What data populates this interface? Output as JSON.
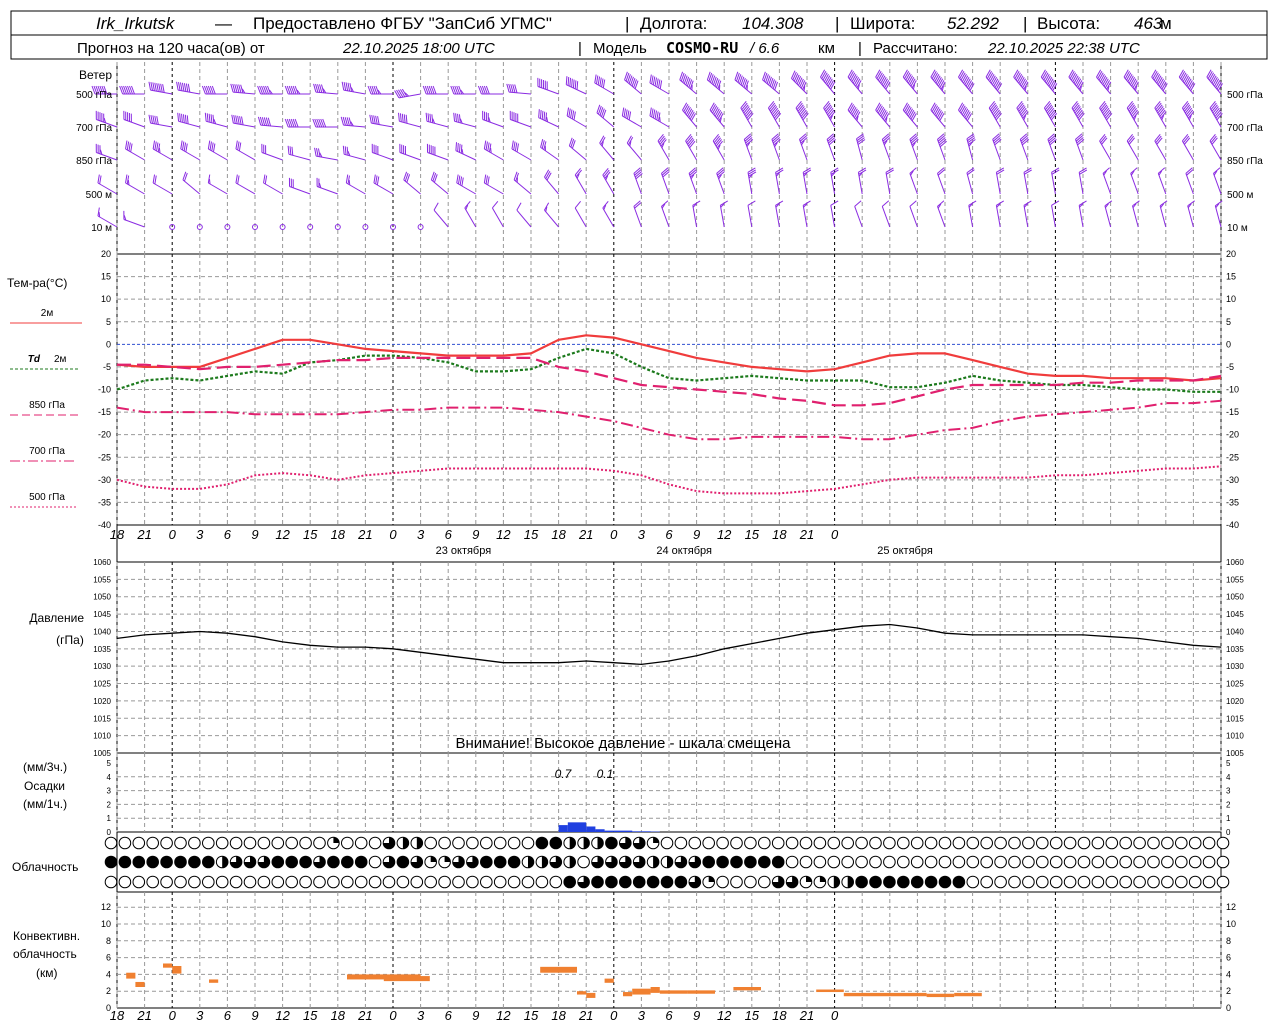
{
  "header": {
    "station": "Irk_Irkutsk",
    "sep1": "—",
    "provided": "Предоставлено ФГБУ \"ЗапСиб УГМС\"",
    "lon_label": "Долгота:",
    "lon": "104.308",
    "lat_label": "Широта:",
    "lat": "52.292",
    "alt_label": "Высота:",
    "alt": "463",
    "alt_unit": "м",
    "forecast_label": "Прогноз на 120 часа(ов) от",
    "forecast_start": "22.10.2025 18:00 UTC",
    "model_label": "Модель",
    "model": "COSMO-RU",
    "model_res": "/ 6.6",
    "model_res_unit": "км",
    "calc_label": "Рассчитано:",
    "calc_time": "22.10.2025 22:38 UTC"
  },
  "time_axis": {
    "hour_ticks": [
      "18",
      "21",
      "0",
      "3",
      "6",
      "9",
      "12",
      "15",
      "18",
      "21",
      "0",
      "3",
      "6",
      "9",
      "12",
      "15",
      "18",
      "21",
      "0",
      "3",
      "6",
      "9",
      "12",
      "15",
      "18",
      "21",
      "0"
    ],
    "day_labels": [
      "23 октября",
      "24 октября",
      "25 октября"
    ]
  },
  "wind": {
    "title": "Ветер",
    "levels": [
      "500 гПа",
      "700 гПа",
      "850 гПа",
      "500 м",
      "10 м"
    ]
  },
  "temperature": {
    "title": "Тем-ра(°C)",
    "ticks": [
      "20",
      "15",
      "10",
      "5",
      "0",
      "-5",
      "-10",
      "-15",
      "-20",
      "-25",
      "-30",
      "-35",
      "-40"
    ],
    "legend": [
      {
        "label": "2м",
        "color": "#f03c3c"
      },
      {
        "label": "Td",
        "label2": "2м",
        "color": "#1c7a1c"
      },
      {
        "label": "850 гПа",
        "color": "#e0206e"
      },
      {
        "label": "700 гПа",
        "color": "#e0206e"
      },
      {
        "label": "500 гПа",
        "color": "#e0206e"
      }
    ]
  },
  "pressure": {
    "title": "Давление",
    "unit": "(гПа)",
    "ticks": [
      "1060",
      "1055",
      "1050",
      "1045",
      "1040",
      "1035",
      "1030",
      "1025",
      "1020",
      "1015",
      "1010",
      "1005"
    ],
    "warning": "Внимание! Высокое давление - шкала смещена"
  },
  "precip": {
    "unit3": "(мм/3ч.)",
    "title": "Осадки",
    "unit1": "(мм/1ч.)",
    "ticks": [
      "5",
      "4",
      "3",
      "2",
      "1",
      "0"
    ],
    "labels": [
      "0.7",
      "0.1"
    ]
  },
  "cloud": {
    "title": "Облачность"
  },
  "conv": {
    "title1": "Конвективн.",
    "title2": "облачность",
    "unit": "(км)",
    "ticks": [
      "12",
      "10",
      "8",
      "6",
      "4",
      "2",
      "0"
    ]
  },
  "colors": {
    "wind": "#8a2be2",
    "t2m": "#f03c3c",
    "td": "#1c7a1c",
    "t850": "#e0206e",
    "zero_line": "#3050d0",
    "pressure": "#000000",
    "precip": "#2040e0",
    "conv": "#f08030"
  },
  "chart_data": [
    {
      "type": "line",
      "title": "Тем-ра(°C)",
      "x_hours": [
        0,
        3,
        6,
        9,
        12,
        15,
        18,
        21,
        24,
        27,
        30,
        33,
        36,
        39,
        42,
        45,
        48,
        51,
        54,
        57,
        60,
        63,
        66,
        69,
        72,
        75,
        78,
        81,
        84,
        87,
        90,
        93,
        96,
        99,
        102,
        105,
        108,
        111,
        114,
        117,
        120
      ],
      "ylim": [
        -40,
        20
      ],
      "series": [
        {
          "name": "2м",
          "values": [
            -4.5,
            -5,
            -5,
            -5,
            -3,
            -1,
            1,
            1,
            0,
            -1,
            -1.5,
            -2,
            -2.5,
            -2.5,
            -2.5,
            -2,
            1,
            2,
            1.5,
            0,
            -1.5,
            -3,
            -4,
            -5,
            -5.5,
            -6,
            -5.5,
            -4,
            -2.5,
            -2,
            -2,
            -3.5,
            -5,
            -6.5,
            -7,
            -7,
            -7.5,
            -7.5,
            -7.5,
            -8,
            -7.5
          ]
        },
        {
          "name": "Td 2м",
          "values": [
            -10,
            -8,
            -7.5,
            -8,
            -7,
            -6,
            -6.5,
            -4,
            -3.5,
            -2.5,
            -2.5,
            -3,
            -4,
            -6,
            -6,
            -5.5,
            -3,
            -1,
            -2,
            -5,
            -7.5,
            -8,
            -7.5,
            -7,
            -7.5,
            -8,
            -8,
            -8,
            -9.5,
            -9.5,
            -8.5,
            -7,
            -8,
            -8.5,
            -9,
            -9,
            -9.5,
            -10,
            -10,
            -10.5,
            -10.5
          ]
        },
        {
          "name": "850 гПа",
          "values": [
            -4.5,
            -4.5,
            -5,
            -5.5,
            -5,
            -5,
            -4.5,
            -4,
            -3.5,
            -3.5,
            -3,
            -3,
            -3,
            -3,
            -3,
            -3,
            -5,
            -6,
            -7.5,
            -9,
            -9.5,
            -10,
            -10.5,
            -11,
            -12,
            -12.5,
            -13.5,
            -13.5,
            -13,
            -11.5,
            -10,
            -9,
            -9,
            -9,
            -9,
            -8.5,
            -8.5,
            -8,
            -8,
            -8,
            -7
          ]
        },
        {
          "name": "700 гПа",
          "values": [
            -14,
            -15,
            -15,
            -15,
            -15,
            -15.5,
            -15.5,
            -15.5,
            -15.5,
            -15,
            -14.5,
            -14.5,
            -14,
            -14,
            -14,
            -14.5,
            -15,
            -16,
            -17,
            -18.5,
            -20,
            -21,
            -21,
            -20.5,
            -20.5,
            -20.5,
            -20.5,
            -21,
            -21,
            -20,
            -19,
            -18.5,
            -17,
            -16,
            -15.5,
            -15,
            -14.5,
            -14,
            -13,
            -13,
            -12.5
          ]
        },
        {
          "name": "500 гПа",
          "values": [
            -30,
            -31.5,
            -32,
            -32,
            -31,
            -29,
            -28.5,
            -29,
            -30,
            -29,
            -28.5,
            -28,
            -27.5,
            -27.5,
            -27.5,
            -27.5,
            -27.5,
            -27.5,
            -28,
            -29,
            -31,
            -32.5,
            -33,
            -33,
            -33,
            -32.5,
            -32,
            -31,
            -30,
            -29.5,
            -29.5,
            -29.5,
            -29.5,
            -29.5,
            -29,
            -29,
            -28.5,
            -28,
            -27.5,
            -27.5,
            -27
          ]
        }
      ]
    },
    {
      "type": "line",
      "title": "Давление",
      "x_hours": [
        0,
        3,
        6,
        9,
        12,
        15,
        18,
        21,
        24,
        27,
        30,
        33,
        36,
        39,
        42,
        45,
        48,
        51,
        54,
        57,
        60,
        63,
        66,
        69,
        72,
        75,
        78,
        81,
        84,
        87,
        90,
        93,
        96,
        99,
        102,
        105,
        108,
        111,
        114,
        117,
        120
      ],
      "ylim": [
        1005,
        1060
      ],
      "series": [
        {
          "name": "Давление",
          "values": [
            1038,
            1039,
            1039.5,
            1040,
            1039.5,
            1038.5,
            1037,
            1036,
            1035.5,
            1035.5,
            1035,
            1034,
            1033,
            1032,
            1031,
            1031,
            1031,
            1031.5,
            1031,
            1030.5,
            1031.5,
            1033,
            1035,
            1036.5,
            1038,
            1039.5,
            1040.5,
            1041.5,
            1042,
            1041,
            1039.5,
            1039,
            1039,
            1039,
            1039,
            1039,
            1038.5,
            1038,
            1037,
            1036,
            1035.5
          ]
        }
      ]
    },
    {
      "type": "bar",
      "title": "Осадки",
      "x_hours": [
        48,
        49,
        50,
        51,
        52,
        53,
        54,
        55,
        56,
        57,
        58
      ],
      "ylim": [
        0,
        5
      ],
      "values": [
        0.5,
        0.7,
        0.7,
        0.4,
        0.2,
        0.1,
        0.1,
        0.1,
        0.05,
        0.05,
        0.03
      ]
    },
    {
      "type": "bar",
      "title": "Конвективн. облачность",
      "ylim": [
        0,
        13
      ],
      "segments": [
        {
          "x": [
            1,
            2
          ],
          "base": 3.5,
          "top": 4.2
        },
        {
          "x": [
            2,
            3
          ],
          "base": 2.5,
          "top": 3.1
        },
        {
          "x": [
            5,
            6
          ],
          "base": 4.8,
          "top": 5.3
        },
        {
          "x": [
            6,
            7
          ],
          "base": 4.1,
          "top": 5.0
        },
        {
          "x": [
            10,
            11
          ],
          "base": 3.0,
          "top": 3.4
        },
        {
          "x": [
            25,
            33
          ],
          "base": 3.4,
          "top": 4.0
        },
        {
          "x": [
            29,
            34
          ],
          "base": 3.2,
          "top": 3.8
        },
        {
          "x": [
            46,
            50
          ],
          "base": 4.2,
          "top": 4.9
        },
        {
          "x": [
            50,
            51
          ],
          "base": 1.6,
          "top": 2.0
        },
        {
          "x": [
            51,
            52
          ],
          "base": 1.2,
          "top": 1.8
        },
        {
          "x": [
            53,
            54
          ],
          "base": 3.0,
          "top": 3.5
        },
        {
          "x": [
            55,
            56
          ],
          "base": 1.4,
          "top": 1.9
        },
        {
          "x": [
            56,
            58
          ],
          "base": 1.6,
          "top": 2.3
        },
        {
          "x": [
            58,
            59
          ],
          "base": 1.8,
          "top": 2.5
        },
        {
          "x": [
            59,
            62
          ],
          "base": 1.7,
          "top": 2.1
        },
        {
          "x": [
            62,
            65
          ],
          "base": 1.7,
          "top": 2.1
        },
        {
          "x": [
            67,
            70
          ],
          "base": 2.1,
          "top": 2.5
        },
        {
          "x": [
            76,
            79
          ],
          "base": 1.9,
          "top": 2.2
        },
        {
          "x": [
            79,
            88
          ],
          "base": 1.4,
          "top": 1.8
        },
        {
          "x": [
            88,
            91
          ],
          "base": 1.3,
          "top": 1.7
        },
        {
          "x": [
            91,
            94
          ],
          "base": 1.4,
          "top": 1.8
        }
      ]
    }
  ],
  "wind_speeds": [
    [
      14,
      14,
      16,
      14,
      12,
      13,
      13,
      13,
      11,
      11,
      11,
      11,
      12,
      11,
      10,
      10,
      12,
      14,
      12,
      16,
      14,
      17,
      17,
      17,
      18,
      19,
      18,
      17,
      18,
      17,
      19,
      20,
      20,
      19,
      20,
      19,
      19,
      19,
      20,
      20,
      20
    ],
    [
      11,
      10,
      10,
      12,
      11,
      12,
      12,
      12,
      12,
      11,
      10,
      10,
      9,
      9,
      9,
      10,
      11,
      10,
      10,
      10,
      13,
      16,
      17,
      16,
      16,
      16,
      15,
      15,
      17,
      16,
      16,
      16,
      16,
      15,
      16,
      16,
      16,
      15,
      15,
      15,
      16
    ],
    [
      7,
      8,
      9,
      8,
      8,
      6,
      6,
      6,
      7,
      7,
      8,
      8,
      10,
      9,
      9,
      8,
      7,
      6,
      5,
      5,
      9,
      10,
      11,
      9,
      9,
      7,
      8,
      8,
      7,
      9,
      10,
      9,
      8,
      8,
      8,
      8,
      6,
      6,
      6,
      6,
      6
    ],
    [
      4,
      5,
      4,
      4,
      3,
      4,
      4,
      6,
      5,
      5,
      6,
      6,
      6,
      8,
      6,
      5,
      6,
      5,
      7,
      8,
      6,
      7,
      7,
      7,
      5,
      5,
      5,
      5,
      4,
      3,
      4,
      4,
      4,
      4,
      4,
      4,
      3,
      3,
      3,
      4,
      3
    ],
    [
      3,
      3,
      0,
      0,
      0,
      0,
      0,
      0,
      0,
      0,
      0,
      0,
      2,
      3,
      2,
      2,
      3,
      2,
      3,
      4,
      3,
      3,
      3,
      2,
      3,
      3,
      2,
      2,
      2,
      2,
      3,
      3,
      3,
      3,
      2,
      3,
      3,
      3,
      3,
      3,
      3
    ]
  ],
  "wind_dirs": [
    [
      270,
      270,
      280,
      280,
      270,
      275,
      270,
      270,
      275,
      280,
      270,
      260,
      270,
      270,
      270,
      275,
      290,
      295,
      300,
      310,
      300,
      310,
      310,
      310,
      310,
      315,
      320,
      320,
      320,
      320,
      320,
      320,
      320,
      320,
      320,
      320,
      320,
      320,
      320,
      320,
      320
    ],
    [
      290,
      290,
      280,
      285,
      285,
      280,
      275,
      270,
      270,
      275,
      280,
      285,
      285,
      285,
      290,
      290,
      295,
      300,
      310,
      300,
      300,
      320,
      320,
      330,
      330,
      330,
      330,
      320,
      320,
      320,
      320,
      320,
      330,
      330,
      330,
      330,
      330,
      330,
      330,
      330,
      330
    ],
    [
      290,
      300,
      300,
      300,
      300,
      300,
      290,
      285,
      280,
      285,
      290,
      290,
      290,
      295,
      300,
      300,
      305,
      310,
      320,
      320,
      330,
      330,
      330,
      340,
      340,
      340,
      340,
      345,
      340,
      340,
      340,
      345,
      340,
      340,
      340,
      340,
      330,
      330,
      330,
      330,
      330
    ],
    [
      300,
      300,
      300,
      310,
      300,
      300,
      300,
      290,
      290,
      300,
      300,
      310,
      310,
      300,
      300,
      310,
      320,
      330,
      330,
      340,
      340,
      340,
      340,
      350,
      350,
      350,
      350,
      350,
      350,
      340,
      340,
      345,
      350,
      350,
      350,
      350,
      340,
      340,
      340,
      340,
      340
    ],
    [
      300,
      290,
      0,
      0,
      0,
      0,
      0,
      0,
      0,
      0,
      0,
      0,
      320,
      330,
      330,
      320,
      320,
      330,
      330,
      340,
      340,
      350,
      350,
      350,
      350,
      350,
      350,
      340,
      340,
      340,
      340,
      350,
      350,
      350,
      350,
      350,
      345,
      345,
      345,
      345,
      345
    ]
  ],
  "cloud_rows": [
    "0000000000000000150032200000000442224331000000000000000000000000000000000000000000",
    "4444444423334443444034311334442232033332233444444000000000000000000000000000000000",
    "0000000000000000000000000000000004344444443100003311224444444400000000000000000000"
  ]
}
